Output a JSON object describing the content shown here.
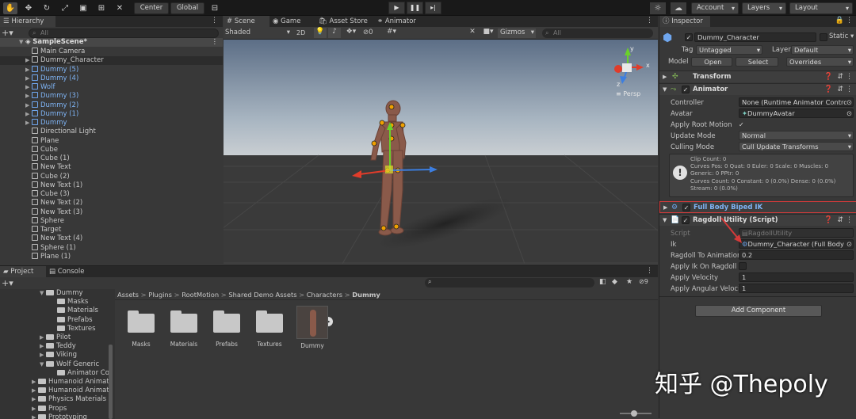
{
  "toolbar": {
    "pivot_center": "Center",
    "pivot_global": "Global",
    "account": "Account",
    "layers": "Layers",
    "layout": "Layout"
  },
  "hierarchy": {
    "tab": "Hierarchy",
    "search_placeholder": "All",
    "scene": "SampleScene*",
    "items": [
      {
        "name": "Main Camera",
        "prefab": false,
        "arrow": false
      },
      {
        "name": "Dummy_Character",
        "prefab": false,
        "arrow": true
      },
      {
        "name": "Dummy (5)",
        "prefab": true,
        "arrow": true
      },
      {
        "name": "Dummy (4)",
        "prefab": true,
        "arrow": true
      },
      {
        "name": "Wolf",
        "prefab": true,
        "arrow": true
      },
      {
        "name": "Dummy (3)",
        "prefab": true,
        "arrow": true
      },
      {
        "name": "Dummy (2)",
        "prefab": true,
        "arrow": true
      },
      {
        "name": "Dummy (1)",
        "prefab": true,
        "arrow": true
      },
      {
        "name": "Dummy",
        "prefab": true,
        "arrow": true
      },
      {
        "name": "Directional Light",
        "prefab": false,
        "arrow": false
      },
      {
        "name": "Plane",
        "prefab": false,
        "arrow": false
      },
      {
        "name": "Cube",
        "prefab": false,
        "arrow": false
      },
      {
        "name": "Cube (1)",
        "prefab": false,
        "arrow": false
      },
      {
        "name": "New Text",
        "prefab": false,
        "arrow": false
      },
      {
        "name": "Cube (2)",
        "prefab": false,
        "arrow": false
      },
      {
        "name": "New Text (1)",
        "prefab": false,
        "arrow": false
      },
      {
        "name": "Cube (3)",
        "prefab": false,
        "arrow": false
      },
      {
        "name": "New Text (2)",
        "prefab": false,
        "arrow": false
      },
      {
        "name": "New Text (3)",
        "prefab": false,
        "arrow": false
      },
      {
        "name": "Sphere",
        "prefab": false,
        "arrow": false
      },
      {
        "name": "Target",
        "prefab": false,
        "arrow": false
      },
      {
        "name": "New Text (4)",
        "prefab": false,
        "arrow": false
      },
      {
        "name": "Sphere (1)",
        "prefab": false,
        "arrow": false
      },
      {
        "name": "Plane (1)",
        "prefab": false,
        "arrow": false
      }
    ]
  },
  "scene_view": {
    "tabs": [
      "Scene",
      "Game",
      "Asset Store",
      "Animator"
    ],
    "shading": "Shaded",
    "mode_2d": "2D",
    "hidden_count": "0",
    "gizmos": "Gizmos",
    "search_placeholder": "All",
    "persp": "Persp",
    "axis_y": "y",
    "axis_x": "x",
    "axis_z": "z"
  },
  "project": {
    "tabs": [
      "Project",
      "Console"
    ],
    "search_placeholder": "",
    "breadcrumb": [
      "Assets",
      "Plugins",
      "RootMotion",
      "Shared Demo Assets",
      "Characters",
      "Dummy"
    ],
    "tree": [
      {
        "name": "Dummy",
        "depth": 0,
        "open": true
      },
      {
        "name": "Masks",
        "depth": 1,
        "open": false
      },
      {
        "name": "Materials",
        "depth": 1,
        "open": false
      },
      {
        "name": "Prefabs",
        "depth": 1,
        "open": false
      },
      {
        "name": "Textures",
        "depth": 1,
        "open": false
      },
      {
        "name": "Pilot",
        "depth": 0,
        "open": false
      },
      {
        "name": "Teddy",
        "depth": 0,
        "open": false
      },
      {
        "name": "Viking",
        "depth": 0,
        "open": false
      },
      {
        "name": "Wolf Generic",
        "depth": 0,
        "open": true
      },
      {
        "name": "Animator Cor",
        "depth": 1,
        "open": false
      },
      {
        "name": "Humanoid Animat",
        "depth": -1,
        "open": false
      },
      {
        "name": "Humanoid Animat",
        "depth": -1,
        "open": false
      },
      {
        "name": "Physics Materials",
        "depth": -1,
        "open": false
      },
      {
        "name": "Props",
        "depth": -1,
        "open": false
      },
      {
        "name": "Prototyping",
        "depth": -1,
        "open": false
      }
    ],
    "assets": [
      "Masks",
      "Materials",
      "Prefabs",
      "Textures",
      "Dummy"
    ],
    "hidden_count": "9"
  },
  "inspector": {
    "tab": "Inspector",
    "object_name": "Dummy_Character",
    "static_label": "Static",
    "tag_label": "Tag",
    "tag_value": "Untagged",
    "layer_label": "Layer",
    "layer_value": "Default",
    "model_label": "Model",
    "open_btn": "Open",
    "select_btn": "Select",
    "overrides": "Overrides",
    "transform": "Transform",
    "animator": {
      "title": "Animator",
      "controller_label": "Controller",
      "controller_value": "None (Runtime Animator Controll",
      "avatar_label": "Avatar",
      "avatar_value": "DummyAvatar",
      "root_motion_label": "Apply Root Motion",
      "update_mode_label": "Update Mode",
      "update_mode_value": "Normal",
      "culling_label": "Culling Mode",
      "culling_value": "Cull Update Transforms",
      "info": [
        "Clip Count: 0",
        "Curves Pos: 0 Quat: 0 Euler: 0 Scale: 0 Muscles: 0",
        "Generic: 0 PPtr: 0",
        "Curves Count: 0 Constant: 0 (0.0%) Dense: 0 (0.0%)",
        "Stream: 0 (0.0%)"
      ]
    },
    "fbbik": "Full Body Biped IK",
    "ragdoll": {
      "title": "Ragdoll Utility (Script)",
      "script_label": "Script",
      "script_value": "RagdollUtility",
      "ik_label": "Ik",
      "ik_value": "Dummy_Character (Full Body E",
      "to_anim_label": "Ragdoll To Animation",
      "to_anim_value": "0.2",
      "apply_ik_label": "Apply Ik On Ragdoll",
      "velocity_label": "Apply Velocity",
      "velocity_value": "1",
      "ang_velocity_label": "Apply Angular Veloci",
      "ang_velocity_value": "1"
    },
    "add_component": "Add Component"
  },
  "watermark": "知乎 @Thepoly",
  "colors": {
    "accent_blue": "#7fb4f5",
    "highlight_red": "#d33a3a",
    "sky": "#97a9bd",
    "ground": "#3b3b3b"
  }
}
